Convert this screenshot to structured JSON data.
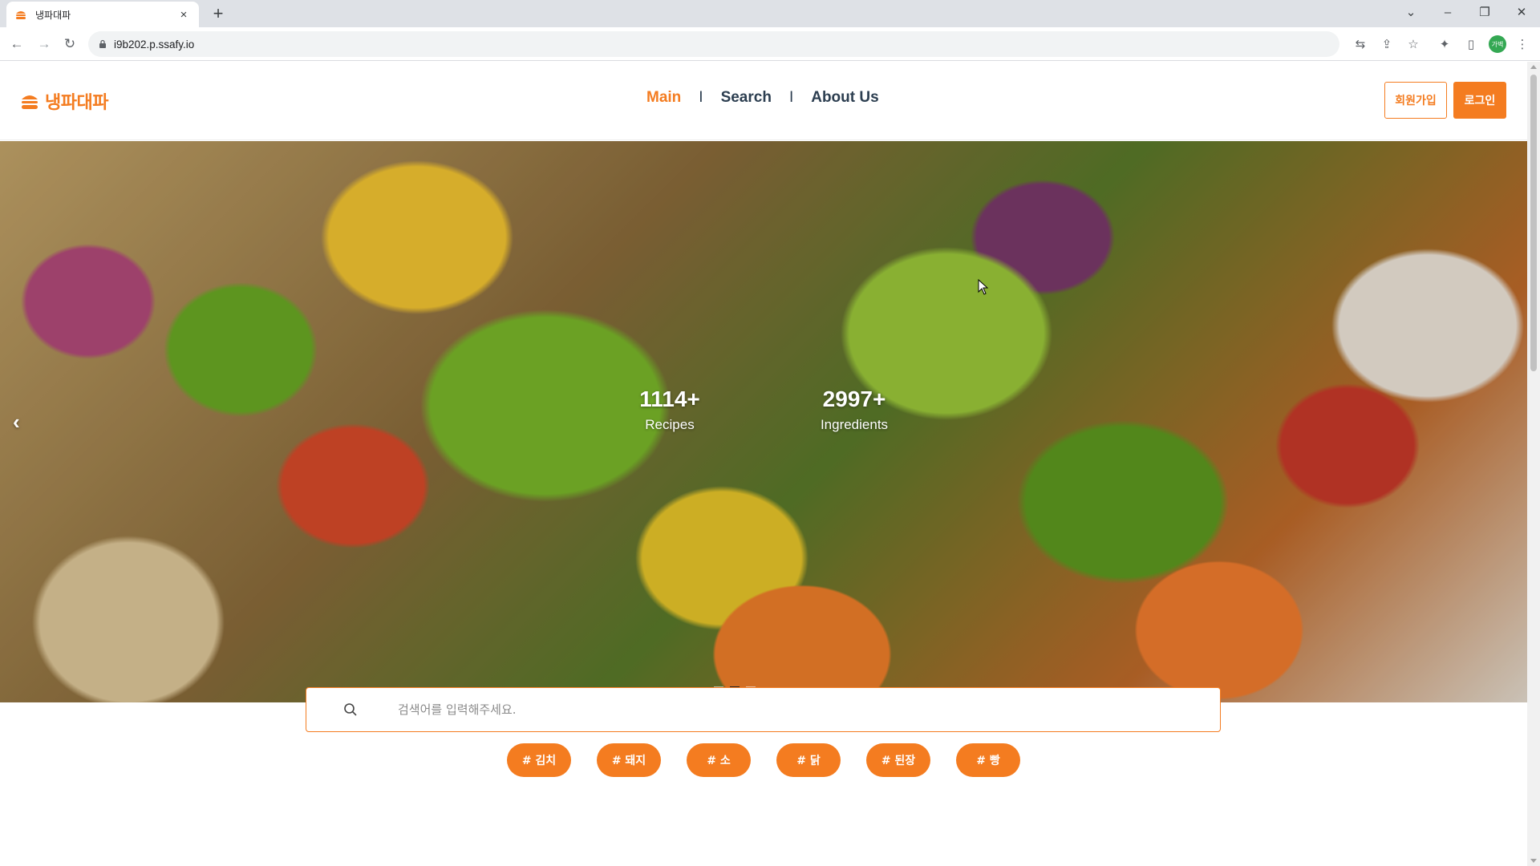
{
  "browser": {
    "tab_title": "냉파대파",
    "tab_close": "×",
    "new_tab": "+",
    "url": "i9b202.p.ssafy.io",
    "profile_initials": "가벽"
  },
  "site": {
    "brand": "냉파대파",
    "nav": {
      "main": "Main",
      "separator": "I",
      "search": "Search",
      "about": "About Us"
    },
    "signup_label": "회원가입",
    "login_label": "로그인",
    "accent_color": "#f47c20"
  },
  "hero": {
    "prev_label": "‹",
    "stats": [
      {
        "value": "1114+",
        "label": "Recipes"
      },
      {
        "value": "2997+",
        "label": "Ingredients"
      }
    ],
    "slide_count": 3,
    "active_slide": 2
  },
  "search": {
    "placeholder": "검색어를 입력해주세요."
  },
  "tags": [
    "# 김치",
    "# 돼지",
    "# 소",
    "# 닭",
    "# 된장",
    "# 빵"
  ]
}
